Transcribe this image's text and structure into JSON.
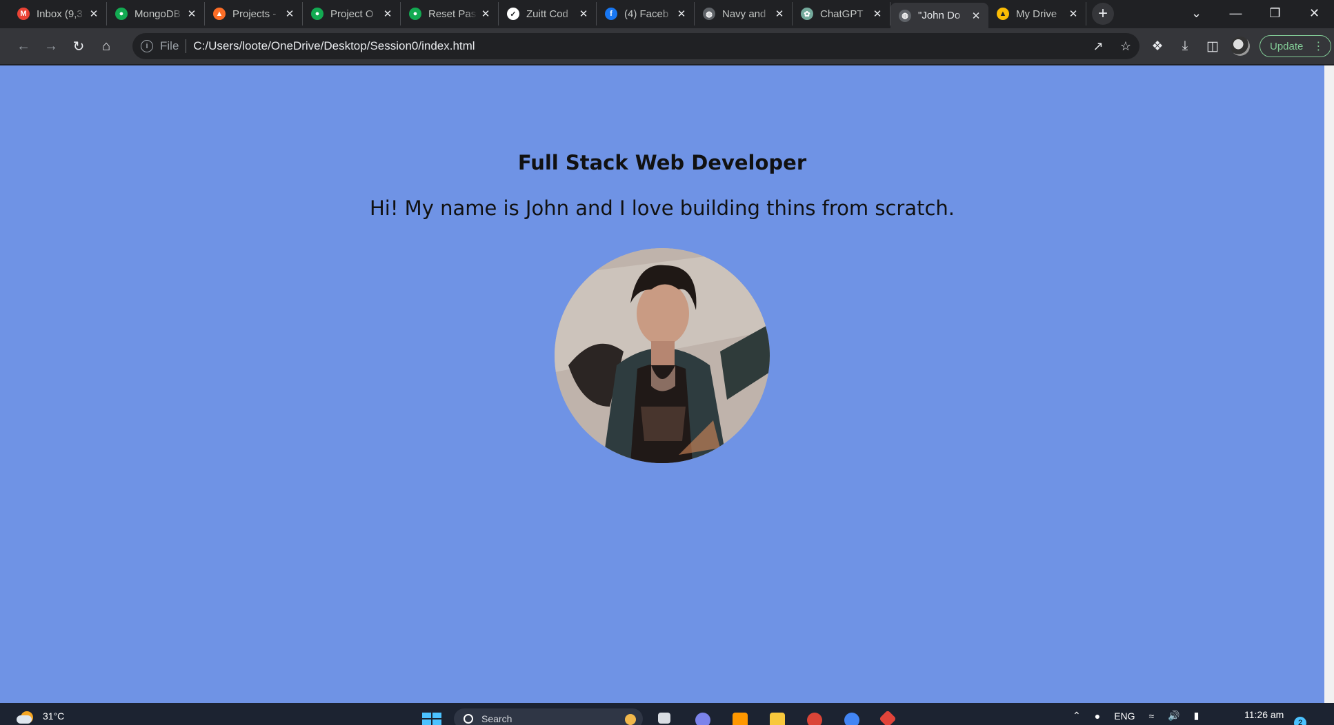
{
  "browser": {
    "tabs": [
      {
        "title": "Inbox (9,3",
        "icon": "gmail-icon",
        "color": "#ea4335",
        "glyph": "M"
      },
      {
        "title": "MongoDB",
        "icon": "mongodb-icon",
        "color": "#13aa52",
        "glyph": "●"
      },
      {
        "title": "Projects -",
        "icon": "gitlab-icon",
        "color": "#fc6d26",
        "glyph": "▲"
      },
      {
        "title": "Project O",
        "icon": "mongodb-icon",
        "color": "#13aa52",
        "glyph": "●"
      },
      {
        "title": "Reset Pas",
        "icon": "mongodb-icon",
        "color": "#13aa52",
        "glyph": "●"
      },
      {
        "title": "Zuitt Cod",
        "icon": "zuitt-icon",
        "color": "#ffffff",
        "glyph": "✓"
      },
      {
        "title": "(4) Faceb",
        "icon": "facebook-icon",
        "color": "#1877f2",
        "glyph": "f"
      },
      {
        "title": "Navy and",
        "icon": "globe-icon",
        "color": "#5f6368",
        "glyph": "◍"
      },
      {
        "title": "ChatGPT",
        "icon": "chatgpt-icon",
        "color": "#74aa9c",
        "glyph": "✿"
      },
      {
        "title": "\"John Do",
        "icon": "globe-icon",
        "color": "#5f6368",
        "glyph": "◍",
        "active": true
      },
      {
        "title": "My Drive",
        "icon": "google-drive-icon",
        "color": "#fbbc04",
        "glyph": "▲"
      }
    ],
    "new_tab": "+",
    "window_controls": {
      "tab_search": "⌄",
      "minimize": "—",
      "restore": "❐",
      "close": "✕"
    },
    "address": {
      "scheme": "File",
      "url": "C:/Users/loote/OneDrive/Desktop/Session0/index.html"
    },
    "update_label": "Update"
  },
  "page": {
    "heading": "Full Stack Web Developer",
    "intro": "Hi! My name is John and I love building thins from scratch.",
    "background_color": "#6f93e5"
  },
  "taskbar": {
    "temperature": "31°C",
    "search_placeholder": "Search",
    "language": "ENG",
    "time": "11:26 am",
    "notifications": "2"
  }
}
